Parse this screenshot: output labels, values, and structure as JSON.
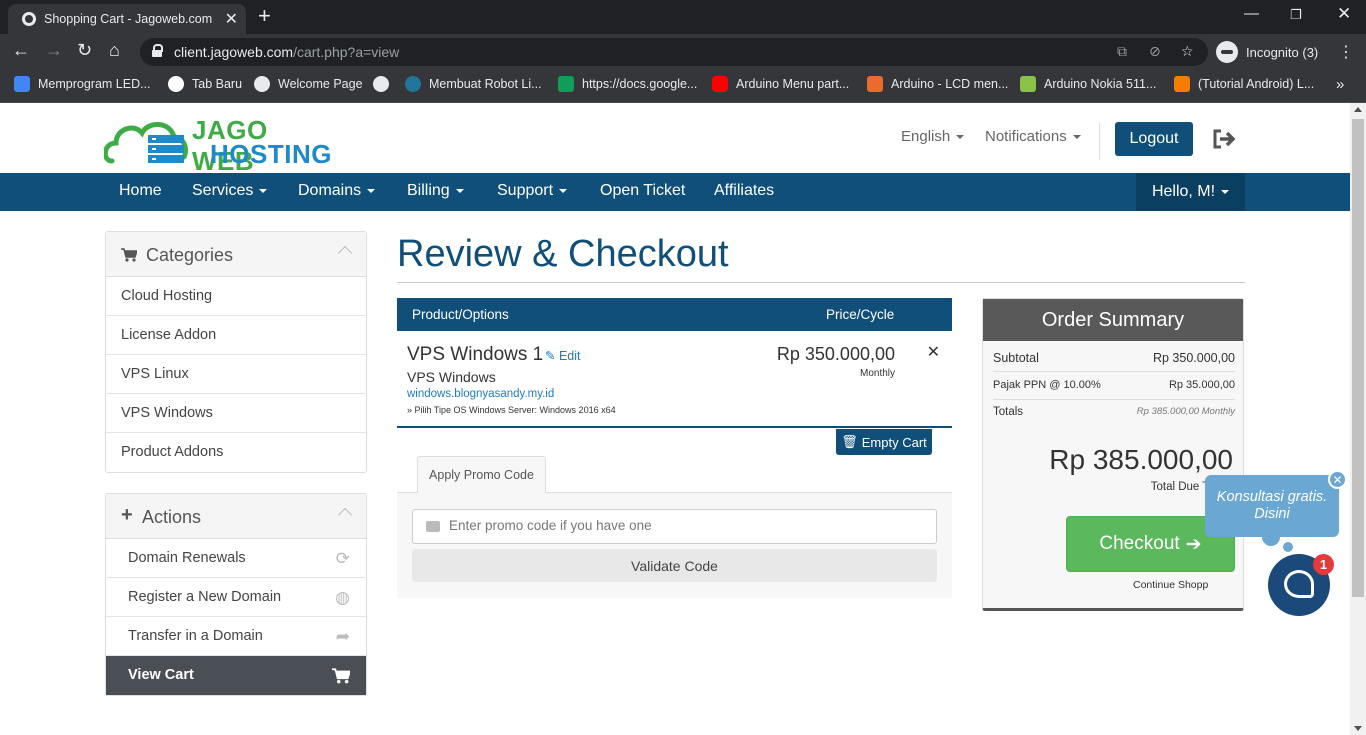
{
  "browser": {
    "tab_title": "Shopping Cart - Jagoweb.com",
    "url_host": "client.jagoweb.com",
    "url_path": "/cart.php?a=view",
    "profile_label": "Incognito (3)",
    "bookmarks": [
      {
        "label": "Memprogram LED...",
        "color": "#4285f4"
      },
      {
        "label": "Tab Baru",
        "color": "#ea4335"
      },
      {
        "label": "Welcome Page",
        "color": "#e8eaed"
      },
      {
        "label": "",
        "color": "#e8eaed"
      },
      {
        "label": "Membuat Robot Li...",
        "color": "#21759b"
      },
      {
        "label": "https://docs.google...",
        "color": "#0f9d58"
      },
      {
        "label": "Arduino Menu part...",
        "color": "#ff0000"
      },
      {
        "label": "Arduino - LCD men...",
        "color": "#e96c2e"
      },
      {
        "label": "Arduino Nokia 511...",
        "color": "#8bc34a"
      },
      {
        "label": "(Tutorial Android) L...",
        "color": "#f57d00"
      }
    ]
  },
  "site": {
    "logo_line1": "JAGO WEB",
    "logo_line2": "HOSTING",
    "language": "English",
    "notifications": "Notifications",
    "logout": "Logout",
    "nav": [
      "Home",
      "Services",
      "Domains",
      "Billing",
      "Support",
      "Open Ticket",
      "Affiliates"
    ],
    "user_menu": "Hello, M!"
  },
  "sidebar": {
    "categories_title": "Categories",
    "categories": [
      "Cloud Hosting",
      "License Addon",
      "VPS Linux",
      "VPS Windows",
      "Product Addons"
    ],
    "actions_title": "Actions",
    "actions": [
      {
        "label": "Domain Renewals",
        "icon": "refresh-icon"
      },
      {
        "label": "Register a New Domain",
        "icon": "globe-icon"
      },
      {
        "label": "Transfer in a Domain",
        "icon": "share-icon"
      },
      {
        "label": "View Cart",
        "icon": "cart-icon"
      }
    ]
  },
  "cart": {
    "title": "Review & Checkout",
    "col_product": "Product/Options",
    "col_price": "Price/Cycle",
    "item": {
      "name": "VPS Windows 1",
      "edit": "Edit",
      "group": "VPS Windows",
      "domain": "windows.blognyasandy.my.id",
      "option": "» Pilih Tipe OS Windows Server: Windows 2016 x64",
      "price": "Rp 350.000,00",
      "cycle": "Monthly"
    },
    "empty_cart": "Empty Cart",
    "promo_tab": "Apply Promo Code",
    "promo_placeholder": "Enter promo code if you have one",
    "validate": "Validate Code"
  },
  "summary": {
    "title": "Order Summary",
    "subtotal_label": "Subtotal",
    "subtotal_value": "Rp 350.000,00",
    "tax_label": "Pajak PPN @ 10.00%",
    "tax_value": "Rp 35.000,00",
    "totals_label": "Totals",
    "totals_value": "Rp 385.000,00 Monthly",
    "total_due": "Rp 385.000,00",
    "total_due_label": "Total Due Today",
    "checkout": "Checkout",
    "continue": "Continue Shopp"
  },
  "chat": {
    "bubble": "Konsultasi gratis. Disini",
    "badge": "1"
  },
  "colors": {
    "brand_blue": "#0f4f7a",
    "brand_green": "#3fab47",
    "checkout_green": "#5cb85c"
  }
}
